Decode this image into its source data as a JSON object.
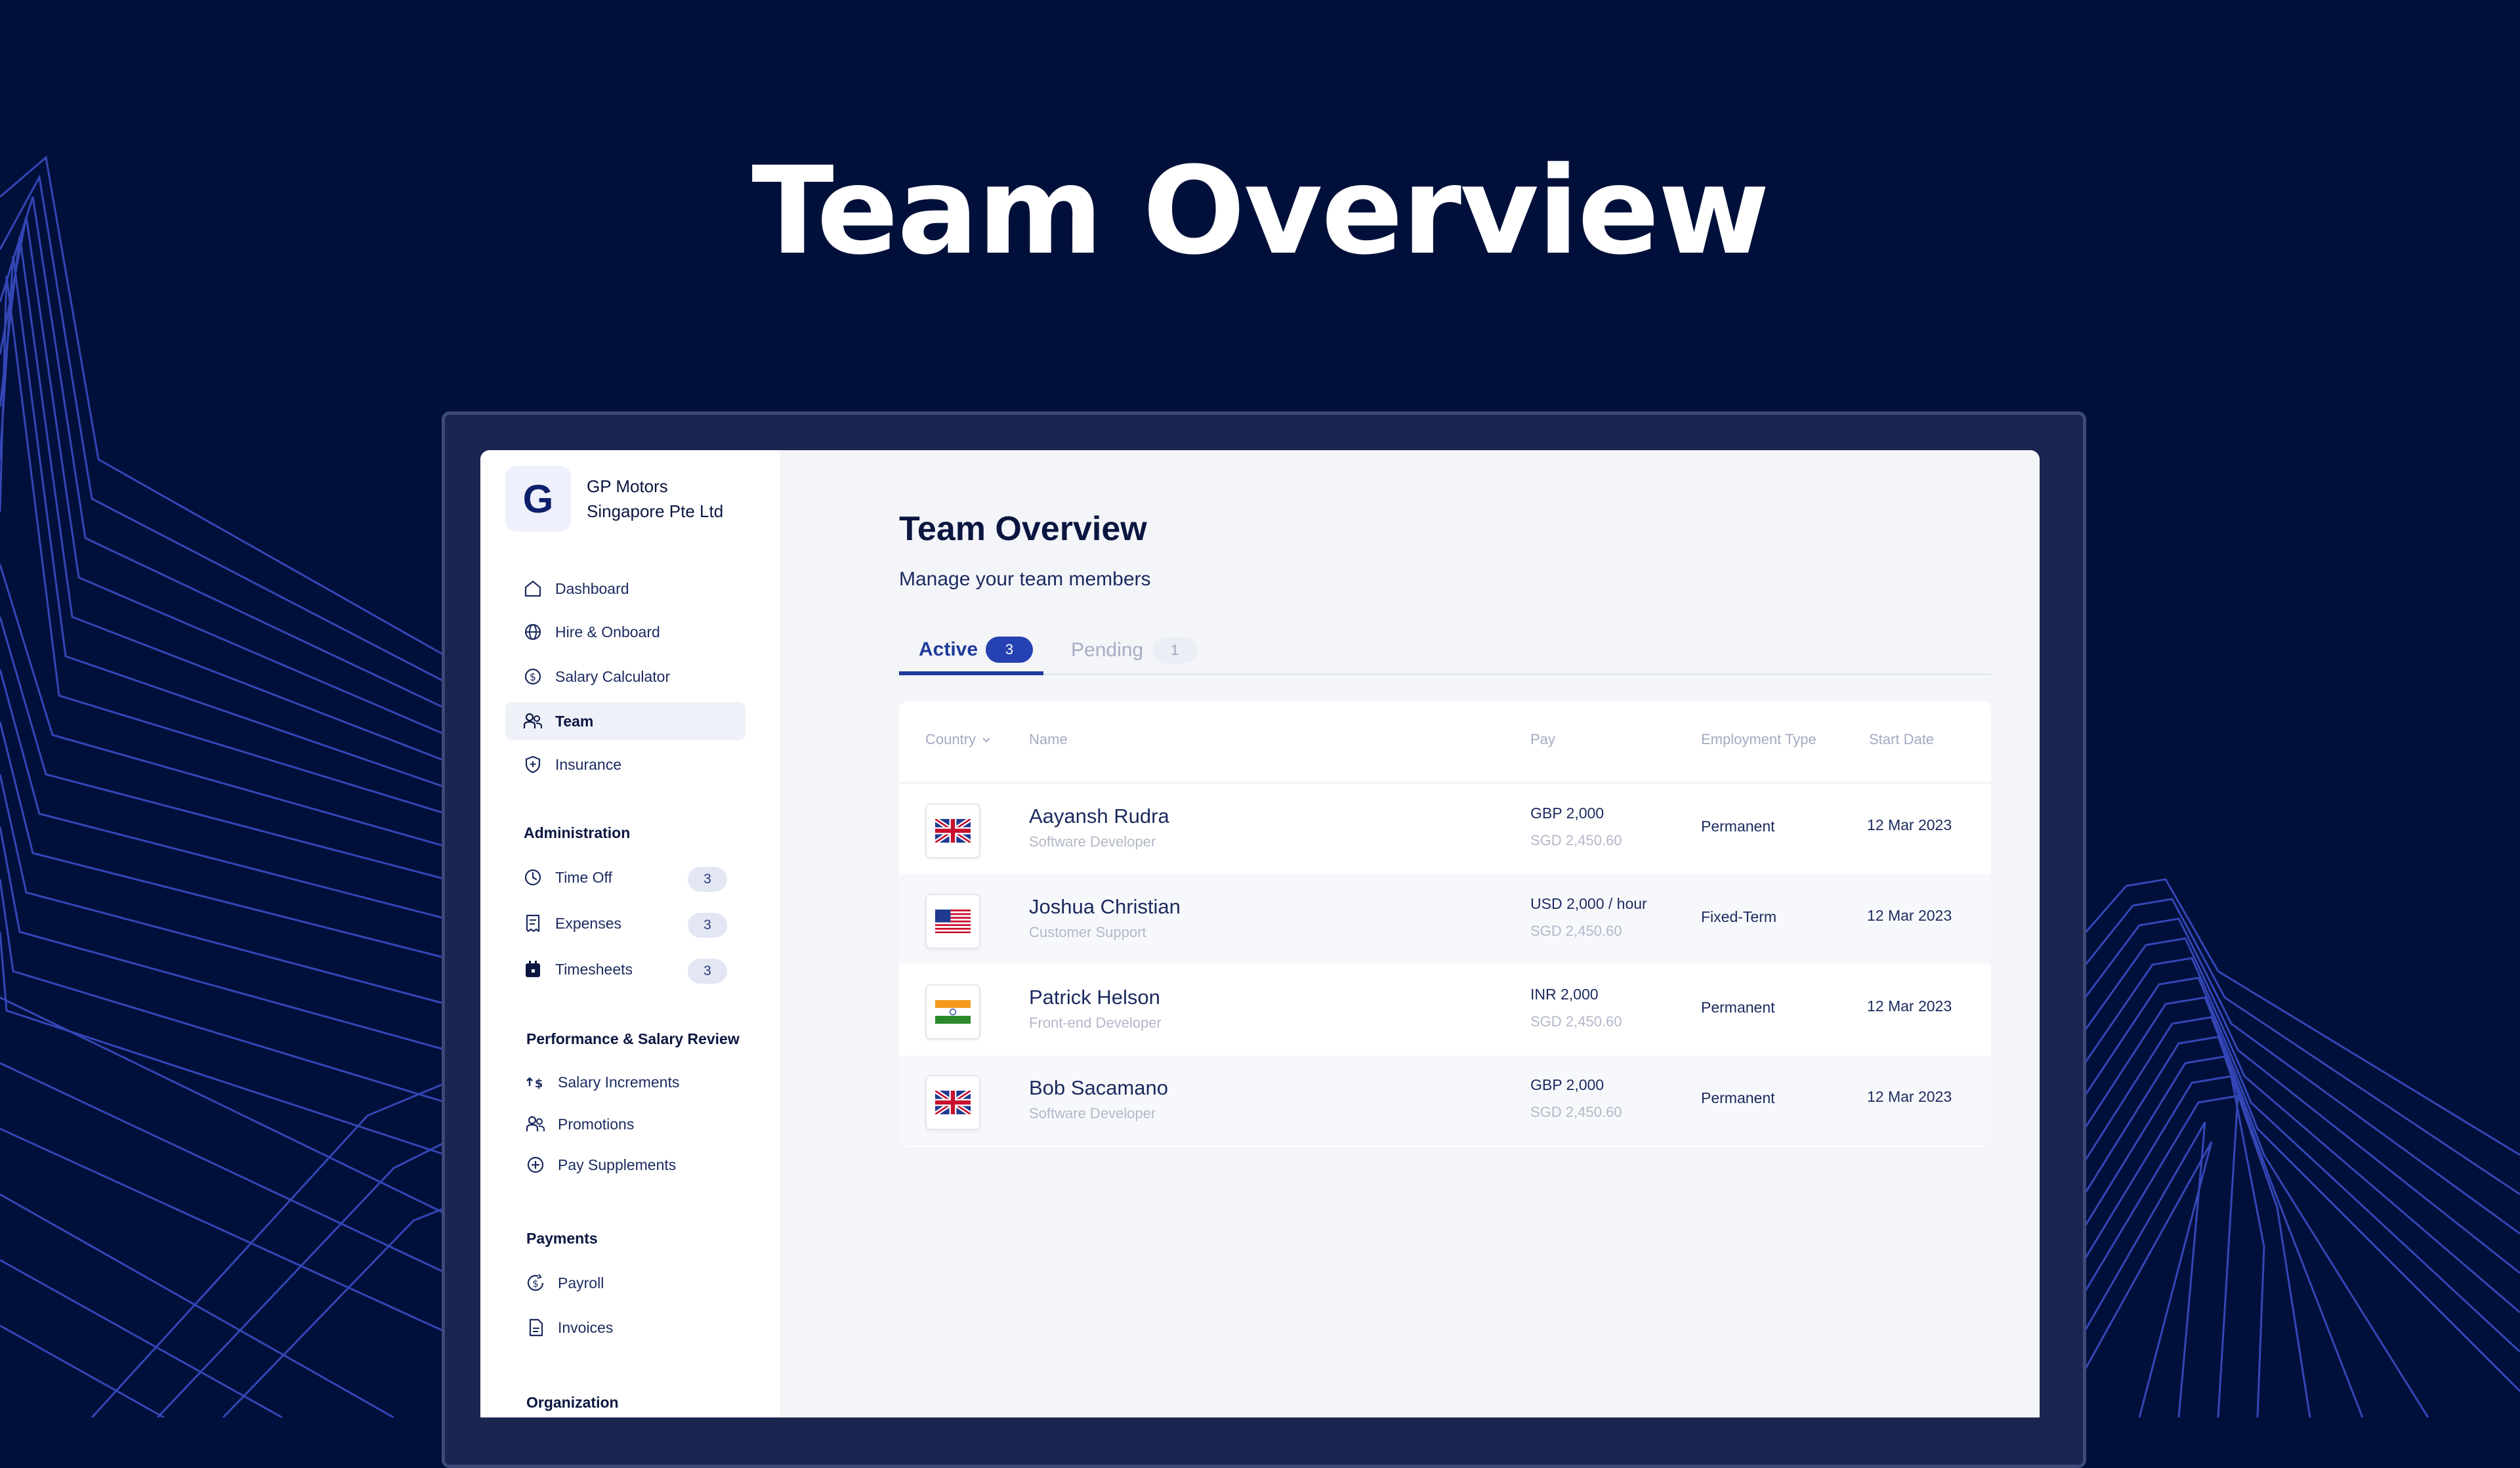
{
  "hero": {
    "title": "Team Overview"
  },
  "org": {
    "logo_letter": "G",
    "name_line1": "GP Motors",
    "name_line2": "Singapore Pte Ltd"
  },
  "nav": {
    "main": [
      {
        "label": "Dashboard",
        "icon": "home-icon"
      },
      {
        "label": "Hire & Onboard",
        "icon": "globe-icon"
      },
      {
        "label": "Salary Calculator",
        "icon": "dollar-circle-icon"
      },
      {
        "label": "Team",
        "icon": "team-icon",
        "active": true
      },
      {
        "label": "Insurance",
        "icon": "shield-icon"
      }
    ],
    "administration": {
      "heading": "Administration",
      "items": [
        {
          "label": "Time Off",
          "icon": "clock-icon",
          "badge": "3"
        },
        {
          "label": "Expenses",
          "icon": "receipt-icon",
          "badge": "3"
        },
        {
          "label": "Timesheets",
          "icon": "calendar-icon",
          "badge": "3"
        }
      ]
    },
    "performance": {
      "heading": "Performance & Salary Review",
      "items": [
        {
          "label": "Salary Increments",
          "icon": "salary-up-icon"
        },
        {
          "label": "Promotions",
          "icon": "promotion-icon"
        },
        {
          "label": "Pay Supplements",
          "icon": "plus-circle-icon"
        }
      ]
    },
    "payments": {
      "heading": "Payments",
      "items": [
        {
          "label": "Payroll",
          "icon": "payroll-icon"
        },
        {
          "label": "Invoices",
          "icon": "invoice-icon"
        }
      ]
    },
    "organization": {
      "heading": "Organization"
    }
  },
  "main": {
    "title": "Team Overview",
    "subtitle": "Manage your team members",
    "tabs": [
      {
        "label": "Active",
        "count": "3"
      },
      {
        "label": "Pending",
        "count": "1"
      }
    ]
  },
  "table": {
    "columns": {
      "country": "Country",
      "name": "Name",
      "pay": "Pay",
      "employment_type": "Employment Type",
      "start_date": "Start Date"
    },
    "rows": [
      {
        "flag": "uk-flag-icon",
        "name": "Aayansh Rudra",
        "role": "Software Developer",
        "pay": "GBP 2,000",
        "pay_converted": "SGD 2,450.60",
        "employment_type": "Permanent",
        "start_date": "12 Mar 2023"
      },
      {
        "flag": "us-flag-icon",
        "name": "Joshua Christian",
        "role": "Customer Support",
        "pay": "USD 2,000 / hour",
        "pay_converted": "SGD 2,450.60",
        "employment_type": "Fixed-Term",
        "start_date": "12 Mar 2023"
      },
      {
        "flag": "india-flag-icon",
        "name": "Patrick Helson",
        "role": "Front-end Developer",
        "pay": "INR 2,000",
        "pay_converted": "SGD 2,450.60",
        "employment_type": "Permanent",
        "start_date": "12 Mar 2023"
      },
      {
        "flag": "uk-flag-icon",
        "name": "Bob Sacamano",
        "role": "Software Developer",
        "pay": "GBP 2,000",
        "pay_converted": "SGD 2,450.60",
        "employment_type": "Permanent",
        "start_date": "12 Mar 2023"
      }
    ]
  },
  "colors": {
    "background": "#01103a",
    "accent": "#2541b2",
    "line_art": "#3a4cc4"
  }
}
